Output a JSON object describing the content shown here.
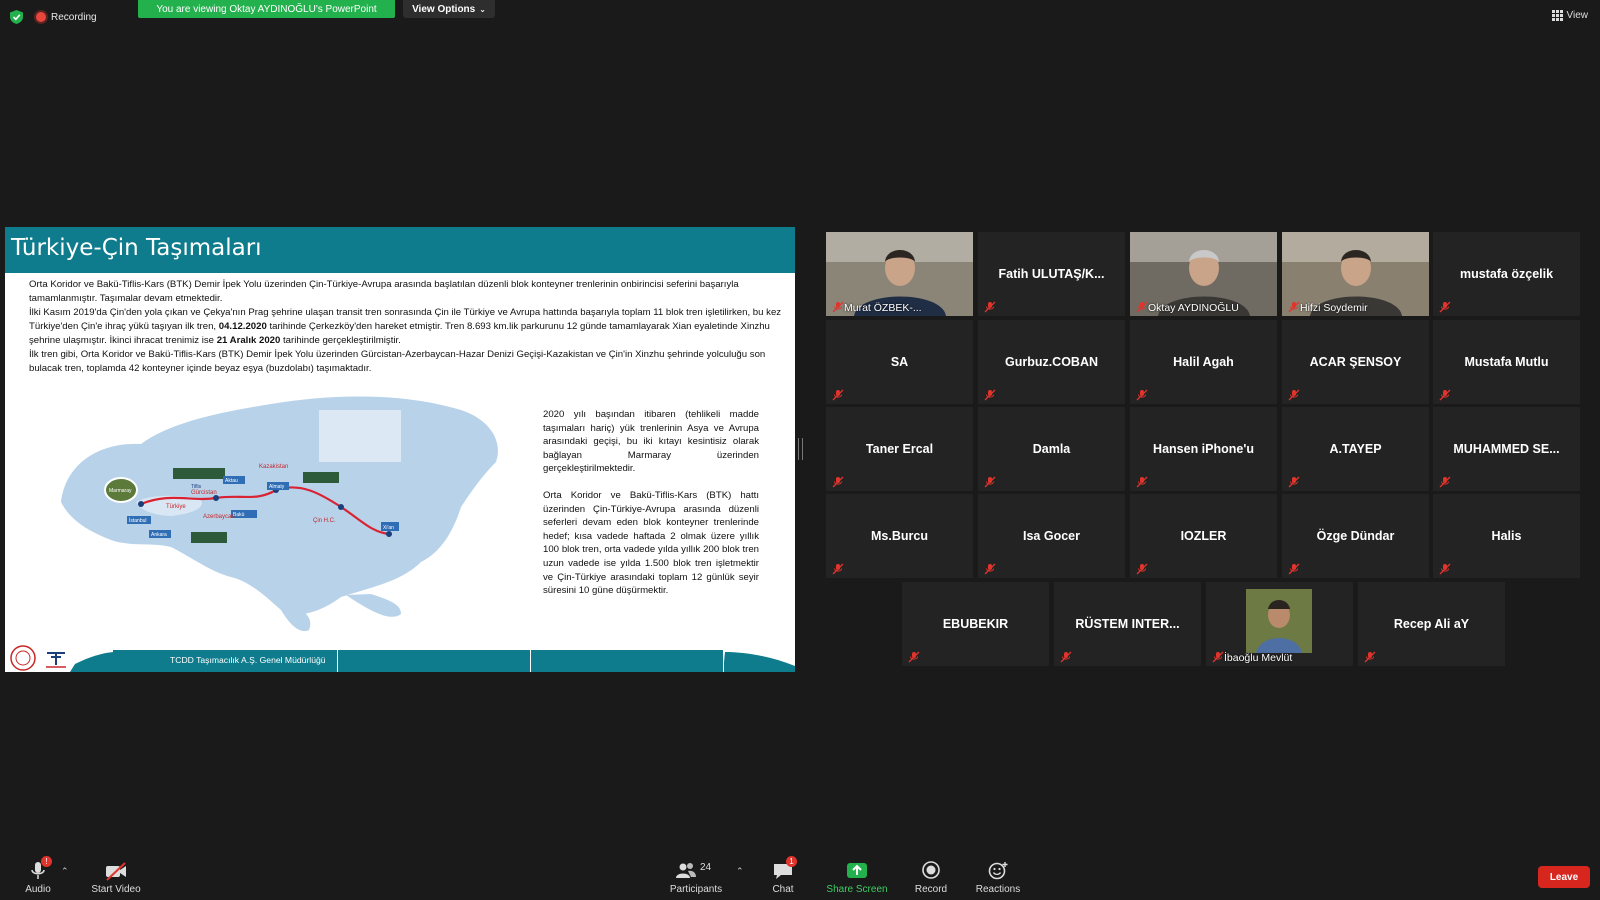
{
  "top": {
    "recording_label": "Recording",
    "viewing_banner": "You are viewing Oktay AYDINOĞLU's PowerPoint",
    "view_options": "View Options",
    "view_label": "View",
    "colors": {
      "banner": "#23b14d",
      "record_dot": "#e8453c",
      "active_speaker": "#e6e44a",
      "leave": "#d7261e"
    }
  },
  "slide": {
    "title": "Türkiye-Çin Taşımaları",
    "p1": "Orta Koridor ve Bakü-Tiflis-Kars (BTK) Demir İpek Yolu üzerinden Çin-Türkiye-Avrupa arasında başlatılan düzenli blok konteyner trenlerinin onbirincisi seferini başarıyla tamamlanmıştır. Taşımalar devam etmektedir.",
    "p2a": "İlki Kasım 2019'da Çin'den yola çıkan ve Çekya'nın Prag şehrine ulaşan transit tren sonrasında Çin ile Türkiye ve Avrupa hattında başarıyla toplam 11 blok tren işletilirken,  bu kez Türkiye'den Çin'e ihraç yükü taşıyan ilk tren, ",
    "p2_date1": "04.12.2020",
    "p2b": " tarihinde Çerkezköy'den hareket etmiştir. Tren 8.693 km.lik parkurunu 12 günde tamamlayarak Xian eyaletinde  Xinzhu şehrine ulaşmıştır. İkinci ihracat trenimiz ise ",
    "p2_date2": "21 Aralık 2020",
    "p2c": " tarihinde gerçekleştirilmiştir.",
    "p3": "İlk tren gibi, Orta Koridor ve Bakü-Tiflis-Kars (BTK) Demir İpek Yolu üzerinden Gürcistan-Azerbaycan-Hazar Denizi Geçişi-Kazakistan ve Çin'in Xinzhu şehrinde yolculuğu son bulacak tren, toplamda 42 konteyner içinde beyaz eşya (buzdolabı) taşımaktadır.",
    "r1": "2020 yılı başından itibaren (tehlikeli madde taşımaları hariç) yük trenlerinin Asya ve Avrupa arasındaki geçişi, bu iki kıtayı kesintisiz olarak bağlayan Marmaray üzerinden gerçekleştirilmektedir.",
    "r2": "Orta Koridor ve Bakü-Tiflis-Kars (BTK) hattı üzerinden Çin-Türkiye-Avrupa arasında düzenli seferleri devam eden blok konteyner trenlerinde hedef; kısa vadede haftada 2 olmak üzere yıllık 100 blok tren, orta vadede yılda yıllık 200 blok tren uzun vadede ise yılda 1.500 blok tren işletmektir ve Çin-Türkiye arasındaki toplam 12 günlük seyir süresini 10 güne düşürmektir.",
    "footer": "TCDD Taşımacılık A.Ş. Genel Müdürlüğü",
    "map_labels": [
      "Gürcistan",
      "Türkiye",
      "Azerbaycan",
      "Kazakistan",
      "Çin H.C.",
      "Xi'an",
      "Tiflis",
      "Bakü",
      "Almaty",
      "Aktau",
      "Ankara",
      "İstanbul",
      "Marmaray"
    ]
  },
  "participants": [
    {
      "name": "Murat ÖZBEK-...",
      "video": true
    },
    {
      "name": "Fatih ULUTAŞ/K...",
      "video": false
    },
    {
      "name": "Oktay AYDINOĞLU",
      "video": true,
      "active": true
    },
    {
      "name": "Hifzi Soydemir",
      "video": true
    },
    {
      "name": "mustafa özçelik",
      "video": false
    },
    {
      "name": "SA",
      "video": false
    },
    {
      "name": "Gurbuz.COBAN",
      "video": false
    },
    {
      "name": "Halil Agah",
      "video": false
    },
    {
      "name": "ACAR ŞENSOY",
      "video": false
    },
    {
      "name": "Mustafa Mutlu",
      "video": false
    },
    {
      "name": "Taner Ercal",
      "video": false
    },
    {
      "name": "Damla",
      "video": false
    },
    {
      "name": "Hansen iPhone'u",
      "video": false
    },
    {
      "name": "A.TAYEP",
      "video": false
    },
    {
      "name": "MUHAMMED  SE...",
      "video": false
    },
    {
      "name": "Ms.Burcu",
      "video": false
    },
    {
      "name": "Isa Gocer",
      "video": false
    },
    {
      "name": "IOZLER",
      "video": false
    },
    {
      "name": "Özge Dündar",
      "video": false
    },
    {
      "name": "Halis",
      "video": false
    },
    {
      "name": "EBUBEKIR",
      "video": false
    },
    {
      "name": "RÜSTEM  INTER...",
      "video": false
    },
    {
      "name": "İbaoğlu Mevlüt",
      "video": false,
      "photo": true
    },
    {
      "name": "Recep Ali aY",
      "video": false
    }
  ],
  "toolbar": {
    "audio": "Audio",
    "audio_badge": "!",
    "start_video": "Start Video",
    "participants": "Participants",
    "participants_count": "24",
    "chat": "Chat",
    "chat_badge": "1",
    "share_screen": "Share Screen",
    "record": "Record",
    "reactions": "Reactions",
    "leave": "Leave"
  }
}
